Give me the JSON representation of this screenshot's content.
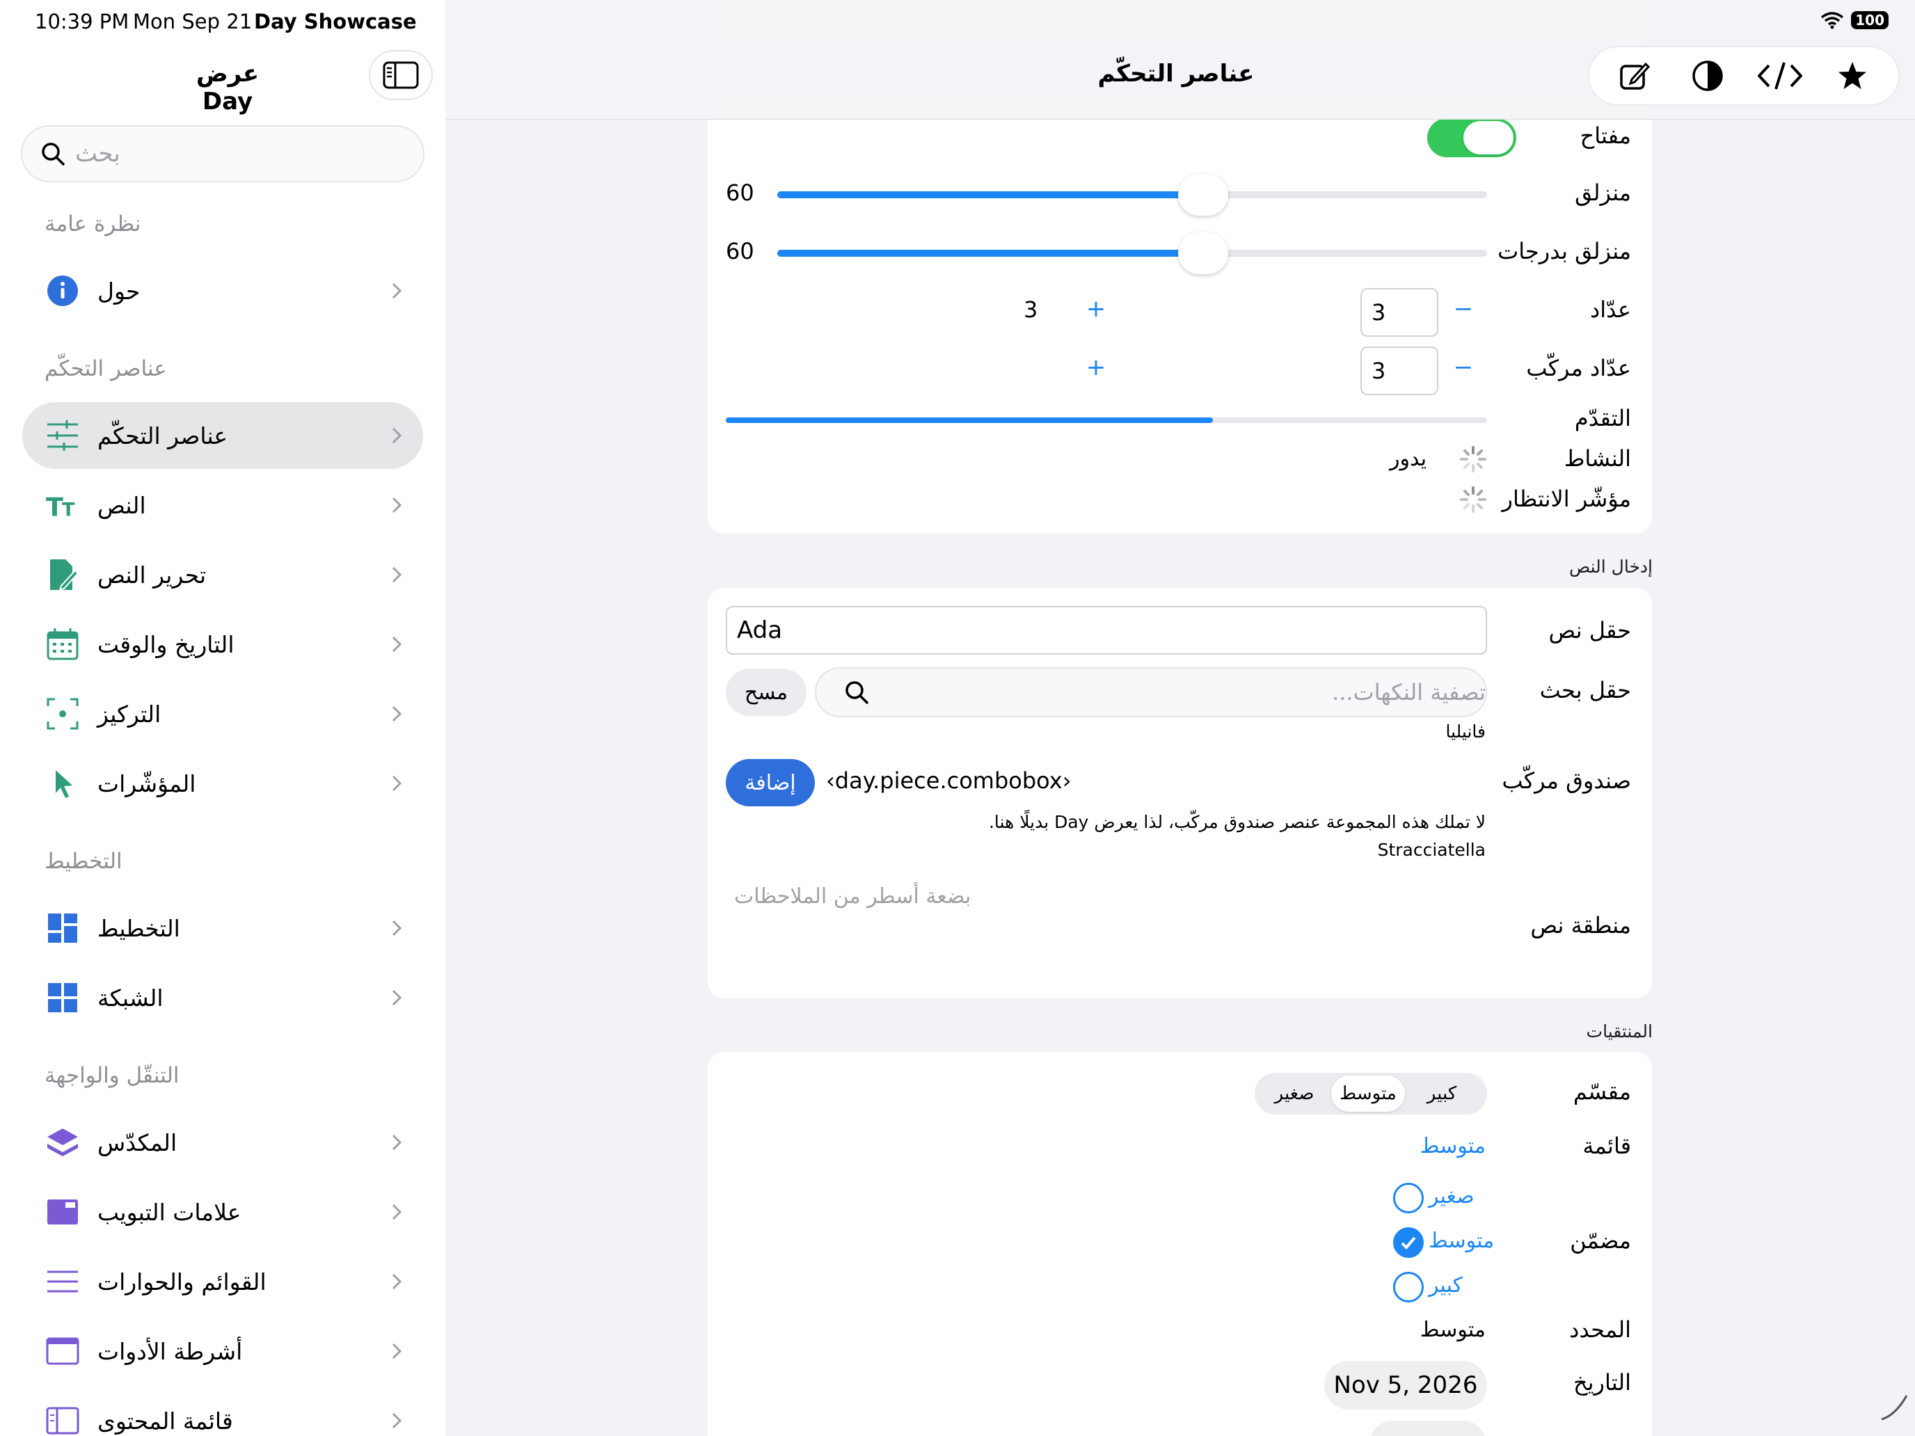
{
  "status": {
    "time": "10:39 PM",
    "date": "Mon Sep 21",
    "app": "Day Showcase",
    "battery": "100"
  },
  "sidebar": {
    "title": "عرض Day",
    "search_placeholder": "بحث",
    "sections": [
      {
        "header": "نظرة عامة",
        "items": [
          {
            "label": "حول",
            "icon": "info-icon"
          }
        ]
      },
      {
        "header": "عناصر التحكّم",
        "items": [
          {
            "label": "عناصر التحكّم",
            "icon": "sliders-icon",
            "active": true
          },
          {
            "label": "النص",
            "icon": "text-size-icon"
          },
          {
            "label": "تحرير النص",
            "icon": "edit-document-icon"
          },
          {
            "label": "التاريخ والوقت",
            "icon": "calendar-icon"
          },
          {
            "label": "التركيز",
            "icon": "focus-icon"
          },
          {
            "label": "المؤشّرات",
            "icon": "pointer-icon"
          }
        ]
      },
      {
        "header": "التخطيط",
        "items": [
          {
            "label": "التخطيط",
            "icon": "layout-icon"
          },
          {
            "label": "الشبكة",
            "icon": "grid-icon"
          }
        ]
      },
      {
        "header": "التنقّل والواجهة",
        "items": [
          {
            "label": "المكدّس",
            "icon": "stack-icon"
          },
          {
            "label": "علامات التبويب",
            "icon": "tabs-icon"
          },
          {
            "label": "القوائم والحوارات",
            "icon": "menu-lines-icon"
          },
          {
            "label": "أشرطة الأدوات",
            "icon": "toolbar-icon"
          },
          {
            "label": "قائمة المحتوى",
            "icon": "content-list-icon"
          }
        ]
      }
    ]
  },
  "nav": {
    "title": "عناصر التحكّم"
  },
  "controls": {
    "switch_label": "مفتاح",
    "slider_label": "منزلق",
    "slider_value": "60",
    "slider_fraction": 0.6,
    "stepped_slider_label": "منزلق بدرجات",
    "stepped_slider_value": "60",
    "stepped_slider_fraction": 0.6,
    "stepper_label": "عدّاد",
    "stepper_value": "3",
    "stepper_display": "3",
    "compound_stepper_label": "عدّاد مركّب",
    "compound_stepper_value": "3",
    "minus": "−",
    "plus": "+",
    "progress_label": "التقدّم",
    "progress_fraction": 0.64,
    "activity_label": "النشاط",
    "activity_text": "يدور",
    "wait_label": "مؤشّر الانتظار"
  },
  "text_input": {
    "section_title": "إدخال النص",
    "textfield_label": "حقل نص",
    "textfield_value": "Ada",
    "searchfield_label": "حقل بحث",
    "searchfield_placeholder": "تصفية النكهات...",
    "clear_button": "مسح",
    "search_result": "فانيليا",
    "combobox_label": "صندوق مركّب",
    "combobox_value": "‹day.piece.combobox›",
    "add_button": "إضافة",
    "combobox_note": "لا تملك هذه المجموعة عنصر صندوق مركّب، لذا يعرض Day بديلًا هنا.",
    "combobox_selected": "Stracciatella",
    "textarea_label": "منطقة نص",
    "textarea_placeholder": "بضعة أسطر من الملاحظات"
  },
  "pickers": {
    "section_title": "المنتقيات",
    "segmented_label": "مقسّم",
    "segments": [
      "كبير",
      "متوسط",
      "صغير"
    ],
    "segment_selected": "متوسط",
    "menu_label": "قائمة",
    "menu_value": "متوسط",
    "inline_label": "مضمّن",
    "inline_options": [
      "صغير",
      "متوسط",
      "كبير"
    ],
    "inline_selected": "متوسط",
    "selected_label": "المحدد",
    "selected_value": "متوسط",
    "date_label": "التاريخ",
    "date_value": "Nov 5, 2026"
  },
  "colors": {
    "accent": "#1c86f2",
    "switch_on": "#34c759",
    "add_button": "#2f6fdc",
    "icon_green": "#2e9c7a",
    "icon_blue": "#2f6fdc",
    "icon_purple": "#7b5ad6"
  }
}
